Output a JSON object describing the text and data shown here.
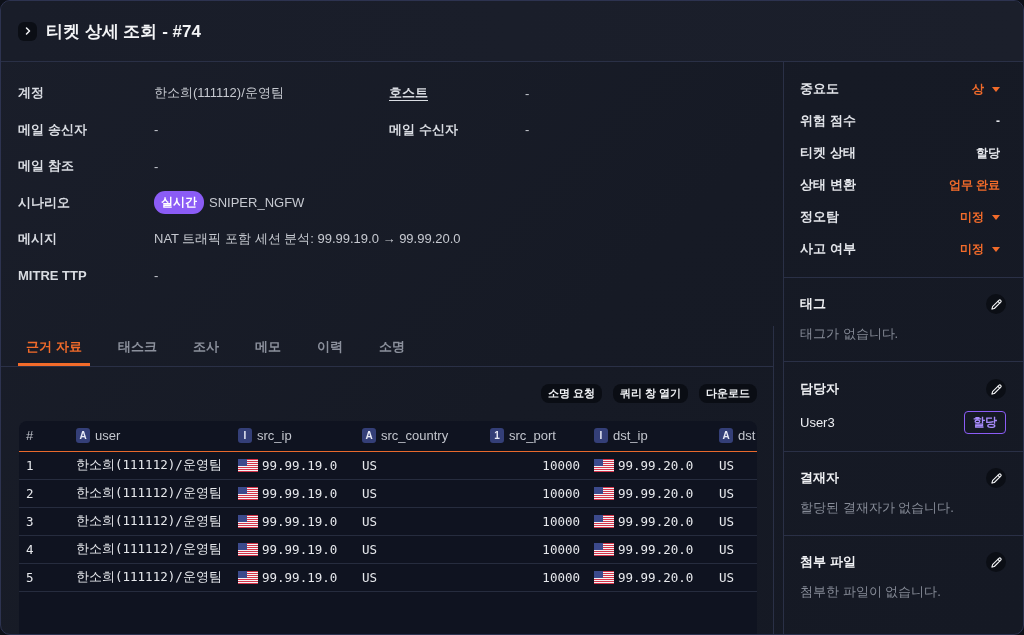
{
  "header": {
    "title": "티켓 상세 조회 - #74"
  },
  "details": [
    {
      "fields": [
        {
          "label": "계정",
          "value": "한소희(111112)/운영팀",
          "link": false
        },
        {
          "label": "호스트",
          "value": "-",
          "link": true
        }
      ]
    },
    {
      "fields": [
        {
          "label": "메일 송신자",
          "value": "-",
          "link": false
        },
        {
          "label": "메일 수신자",
          "value": "-",
          "link": false
        }
      ]
    },
    {
      "fields": [
        {
          "label": "메일 참조",
          "value": "-",
          "link": false
        }
      ]
    },
    {
      "fields": [
        {
          "label": "시나리오",
          "badge": "실시간",
          "value": "SNIPER_NGFW",
          "link": false
        }
      ]
    },
    {
      "fields": [
        {
          "label": "메시지",
          "value": "NAT 트래픽 포함 세션 분석: 99.99.19.0 → 99.99.20.0",
          "link": false
        }
      ]
    },
    {
      "fields": [
        {
          "label": "MITRE TTP",
          "value": "-",
          "link": false
        }
      ]
    }
  ],
  "tabs": [
    {
      "label": "근거 자료",
      "selected": true
    },
    {
      "label": "태스크",
      "selected": false
    },
    {
      "label": "조사",
      "selected": false
    },
    {
      "label": "메모",
      "selected": false
    },
    {
      "label": "이력",
      "selected": false
    },
    {
      "label": "소명",
      "selected": false
    }
  ],
  "actions": [
    "소명 요청",
    "쿼리 창 열기",
    "다운로드"
  ],
  "table": {
    "columns": [
      {
        "label": "#",
        "kind": "index"
      },
      {
        "label": "user",
        "type": "A",
        "kind": "text"
      },
      {
        "label": "src_ip",
        "type": "I",
        "kind": "ip"
      },
      {
        "label": "src_country",
        "type": "A",
        "kind": "text"
      },
      {
        "label": "src_port",
        "type": "1",
        "kind": "number"
      },
      {
        "label": "dst_ip",
        "type": "I",
        "kind": "ip"
      },
      {
        "label": "dst",
        "type": "A",
        "kind": "text"
      }
    ],
    "rows": [
      [
        "1",
        "한소희(111112)/운영팀",
        "99.99.19.0",
        "US",
        "10000",
        "99.99.20.0",
        "US"
      ],
      [
        "2",
        "한소희(111112)/운영팀",
        "99.99.19.0",
        "US",
        "10000",
        "99.99.20.0",
        "US"
      ],
      [
        "3",
        "한소희(111112)/운영팀",
        "99.99.19.0",
        "US",
        "10000",
        "99.99.20.0",
        "US"
      ],
      [
        "4",
        "한소희(111112)/운영팀",
        "99.99.19.0",
        "US",
        "10000",
        "99.99.20.0",
        "US"
      ],
      [
        "5",
        "한소희(111112)/운영팀",
        "99.99.19.0",
        "US",
        "10000",
        "99.99.20.0",
        "US"
      ]
    ]
  },
  "properties": [
    {
      "label": "중요도",
      "value": "상",
      "accent": true,
      "dropdown": true
    },
    {
      "label": "위험 점수",
      "value": "-",
      "accent": false,
      "dropdown": false
    },
    {
      "label": "티켓 상태",
      "value": "할당",
      "accent": false,
      "dropdown": false
    },
    {
      "label": "상태 변환",
      "value": "업무 완료",
      "accent": true,
      "dropdown": false
    },
    {
      "label": "정오탐",
      "value": "미정",
      "accent": true,
      "dropdown": true
    },
    {
      "label": "사고 여부",
      "value": "미정",
      "accent": true,
      "dropdown": true
    }
  ],
  "sections": [
    {
      "kind": "empty",
      "title": "태그",
      "text": "태그가 없습니다."
    },
    {
      "kind": "assignee",
      "title": "담당자",
      "name": "User3",
      "button": "할당"
    },
    {
      "kind": "empty",
      "title": "결재자",
      "text": "할당된 결재자가 없습니다."
    },
    {
      "kind": "empty",
      "title": "첨부 파일",
      "text": "첨부한 파일이 없습니다."
    }
  ]
}
